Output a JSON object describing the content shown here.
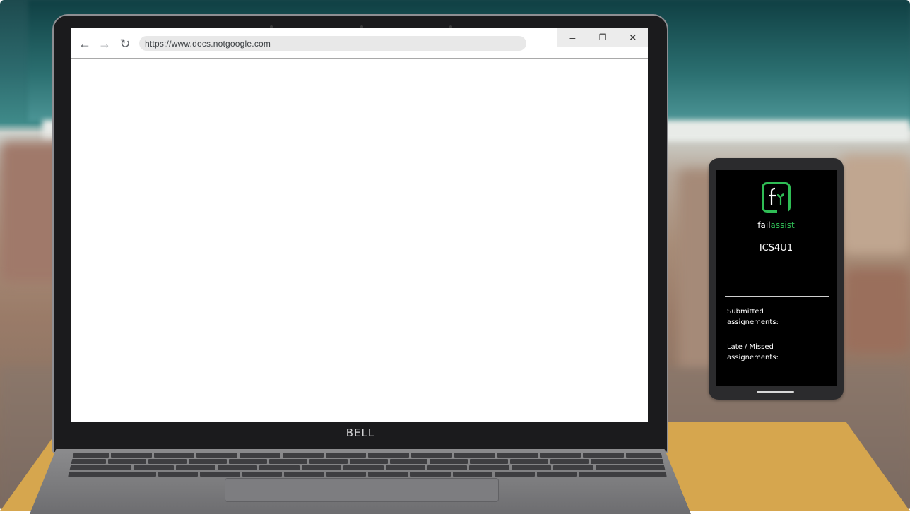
{
  "browser": {
    "url": "https://www.docs.notgoogle.com",
    "nav": {
      "back_icon": "←",
      "forward_icon": "→",
      "reload_icon": "↻"
    },
    "window": {
      "minimize_icon": "–",
      "restore_icon": "❐",
      "close_icon": "✕"
    }
  },
  "laptop": {
    "brand": "BELL"
  },
  "phone": {
    "app_name_prefix": "fail",
    "app_name_suffix": "assist",
    "course_code": "ICS4U1",
    "stats": {
      "submitted_label": "Submitted assignements:",
      "late_label": "Late / Missed assignements:"
    },
    "accent_color": "#2fbd55"
  }
}
